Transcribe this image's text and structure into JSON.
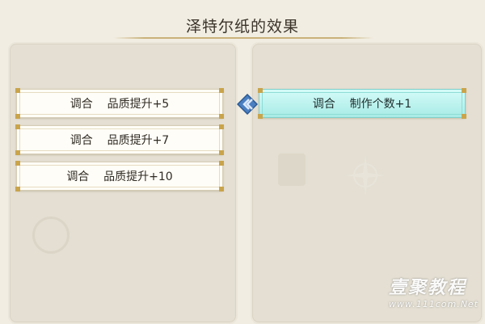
{
  "title": "泽特尔纸的效果",
  "left_options": [
    {
      "label": "调合    品质提升+5"
    },
    {
      "label": "调合    品质提升+7"
    },
    {
      "label": "调合    品质提升+10"
    }
  ],
  "right_options": [
    {
      "label": "调合    制作个数+1"
    }
  ],
  "watermark": {
    "main": "壹聚教程",
    "url": "www.111com.Net"
  },
  "colors": {
    "selected_fill": "#a8ebe6",
    "gold_corner": "#c9a44b",
    "panel_bg": "#e4dfd2"
  },
  "icons": {
    "link_arrow": "blue-diamond-arrow-icon",
    "sparkle": "four-point-star-icon"
  }
}
